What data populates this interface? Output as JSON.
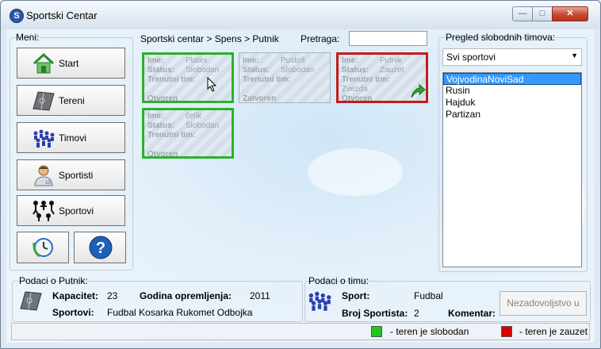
{
  "window": {
    "title": "Sportski Centar",
    "icon": "S"
  },
  "menu": {
    "label": "Meni:",
    "items": [
      {
        "label": "Start",
        "icon": "home-icon"
      },
      {
        "label": "Tereni",
        "icon": "court-icon"
      },
      {
        "label": "Timovi",
        "icon": "team-icon"
      },
      {
        "label": "Sportisti",
        "icon": "athlete-icon"
      },
      {
        "label": "Sportovi",
        "icon": "sports-icon"
      }
    ],
    "clock_icon": "clock-refresh-icon",
    "help_icon": "help-icon"
  },
  "breadcrumb": "Sportski centar > Spens > Putnik",
  "search": {
    "label": "Pretraga:",
    "value": ""
  },
  "courts": [
    {
      "ime_label": "Ime:",
      "ime": "Platini",
      "status_label": "Status:",
      "status": "Slobodan",
      "tim_label": "Trenutni tim:",
      "tim": "",
      "state": "Otvoren"
    },
    {
      "ime_label": "Ime:",
      "ime": "Pustoš",
      "status_label": "Status:",
      "status": "Slobodan",
      "tim_label": "Trenutni tim:",
      "tim": "",
      "state": "Zatvoren"
    },
    {
      "ime_label": "Ime:",
      "ime": "Putnik",
      "status_label": "Status:",
      "status": "Zauzet",
      "tim_label": "Trenutni tim:",
      "tim": "Zvezda",
      "state": "Otvoren"
    },
    {
      "ime_label": "Ime:",
      "ime": "čelik",
      "status_label": "Status:",
      "status": "Slobodan",
      "tim_label": "Trenutni tim:",
      "tim": "",
      "state": "Otvoren"
    }
  ],
  "teams_panel": {
    "label": "Pregled slobodnih timova:",
    "filter": "Svi sportovi",
    "teams": [
      "VojvodinaNoviSad",
      "Rusin",
      "Hajduk",
      "Partizan"
    ],
    "selected_index": 0
  },
  "court_info": {
    "label": "Podaci o Putnik:",
    "kapacitet_label": "Kapacitet:",
    "kapacitet": "23",
    "godina_label": "Godina opremljenja:",
    "godina": "2011",
    "sportovi_label": "Sportovi:",
    "sportovi": "Fudbal Kosarka Rukomet Odbojka"
  },
  "team_info": {
    "label": "Podaci o timu:",
    "sport_label": "Sport:",
    "sport": "Fudbal",
    "broj_label": "Broj Sportista:",
    "broj": "2",
    "komentar_label": "Komentar:",
    "button": "Nezadovoljstvo u"
  },
  "legend": {
    "free_label": "- teren je slobodan",
    "free_color": "#1ec81e",
    "busy_label": "- teren je zauzet",
    "busy_color": "#d40000"
  }
}
